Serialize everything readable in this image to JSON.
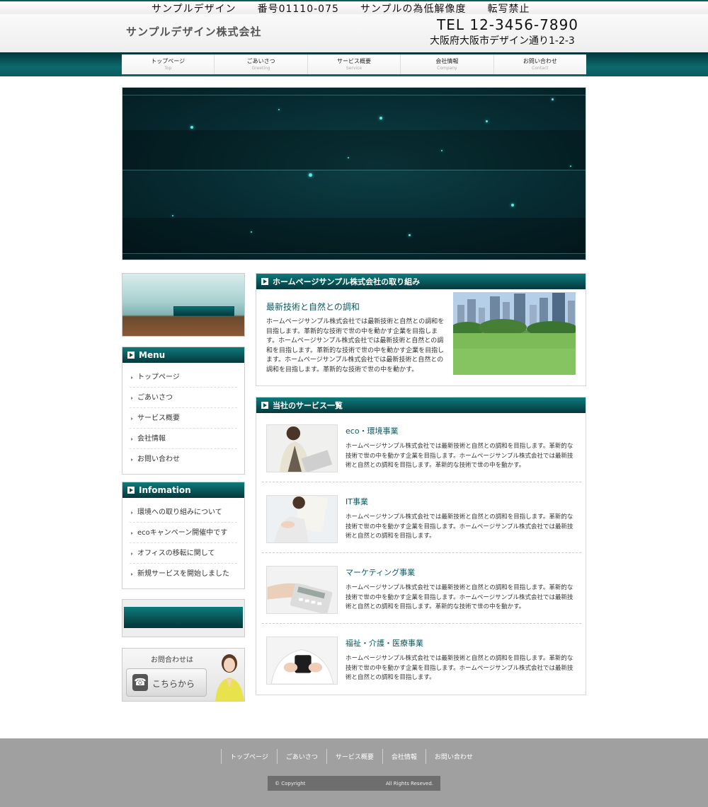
{
  "notice": "サンプルデザイン　　番号01110-075　　サンプルの為低解像度　　転写禁止",
  "header": {
    "company": "サンプルデザイン株式会社",
    "tel": "TEL 12-3456-7890",
    "address": "大阪府大阪市デザイン通り1-2-3"
  },
  "nav": [
    {
      "jp": "トップページ",
      "en": "Top"
    },
    {
      "jp": "ごあいさつ",
      "en": "Greeting"
    },
    {
      "jp": "サービス概要",
      "en": "Service"
    },
    {
      "jp": "会社情報",
      "en": "Company"
    },
    {
      "jp": "お問い合わせ",
      "en": "Contact"
    }
  ],
  "sidebar": {
    "menu_title": "Menu",
    "menu_items": [
      "トップページ",
      "ごあいさつ",
      "サービス概要",
      "会社情報",
      "お問い合わせ"
    ],
    "info_title": "Infomation",
    "info_items": [
      "環境への取り組みについて",
      "ecoキャンペーン開催中です",
      "オフィスの移転に関して",
      "新規サービスを開始しました"
    ],
    "contact_label": "お問合わせは",
    "contact_button": "こちらから"
  },
  "intro": {
    "heading": "ホームページサンプル株式会社の取り組み",
    "title": "最新技術と自然との調和",
    "text": "ホームページサンプル株式会社では最新技術と自然との調和を目指します。革新的な技術で世の中を動かす企業を目指します。ホームページサンプル株式会社では最新技術と自然との調和を目指します。革新的な技術で世の中を動かす企業を目指します。ホームページサンプル株式会社では最新技術と自然との調和を目指します。革新的な技術で世の中を動かす。"
  },
  "services": {
    "heading": "当社のサービス一覧",
    "items": [
      {
        "title": "eco・環境事業",
        "text": "ホームページサンプル株式会社では最新技術と自然との調和を目指します。革新的な技術で世の中を動かす企業を目指します。ホームページサンプル株式会社では最新技術と自然との調和を目指します。革新的な技術で世の中を動かす。"
      },
      {
        "title": "IT事業",
        "text": "ホームページサンプル株式会社では最新技術と自然との調和を目指します。革新的な技術で世の中を動かす企業を目指します。ホームページサンプル株式会社では最新技術と自然との調和を目指します。"
      },
      {
        "title": "マーケティング事業",
        "text": "ホームページサンプル株式会社では最新技術と自然との調和を目指します。革新的な技術で世の中を動かす企業を目指します。ホームページサンプル株式会社では最新技術と自然との調和を目指します。革新的な技術で世の中を動かす。"
      },
      {
        "title": "福祉・介護・医療事業",
        "text": "ホームページサンプル株式会社では最新技術と自然との調和を目指します。革新的な技術で世の中を動かす企業を目指します。ホームページサンプル株式会社では最新技術と自然との調和を目指します。"
      }
    ]
  },
  "footer": {
    "links": [
      "トップページ",
      "ごあいさつ",
      "サービス概要",
      "会社情報",
      "お問い合わせ"
    ],
    "copyright": "© Copyright",
    "rights": "All Rights Reseved."
  },
  "icons": {
    "heading_arrow": "arrow-right-icon",
    "list_bullet": "triangle-bullet-icon",
    "phone": "phone-icon"
  },
  "colors": {
    "accent": "#0d6d6f",
    "accent_dark": "#04383d",
    "footer_bg": "#a0a0a0"
  }
}
